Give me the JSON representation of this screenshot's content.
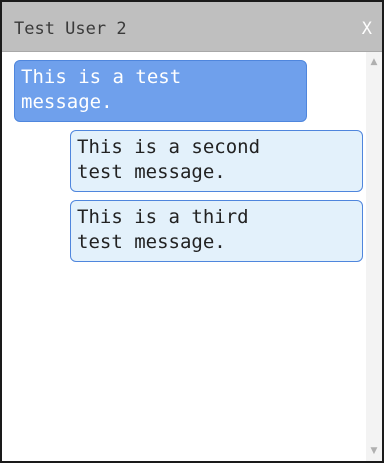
{
  "window": {
    "title": "Test User 2",
    "close_label": "X"
  },
  "messages": [
    {
      "sender": "self",
      "text": "This is a test\nmessage."
    },
    {
      "sender": "other",
      "text": "This is a second\ntest message."
    },
    {
      "sender": "other",
      "text": "This is a third\ntest message."
    }
  ],
  "scrollbar": {
    "up_icon": "chevron-up-icon",
    "down_icon": "chevron-down-icon"
  },
  "colors": {
    "own_message_bg": "#6fa0ec",
    "other_message_bg": "#e3f1fb",
    "bubble_border": "#4f86dd",
    "titlebar_bg": "#bfbfbf"
  }
}
